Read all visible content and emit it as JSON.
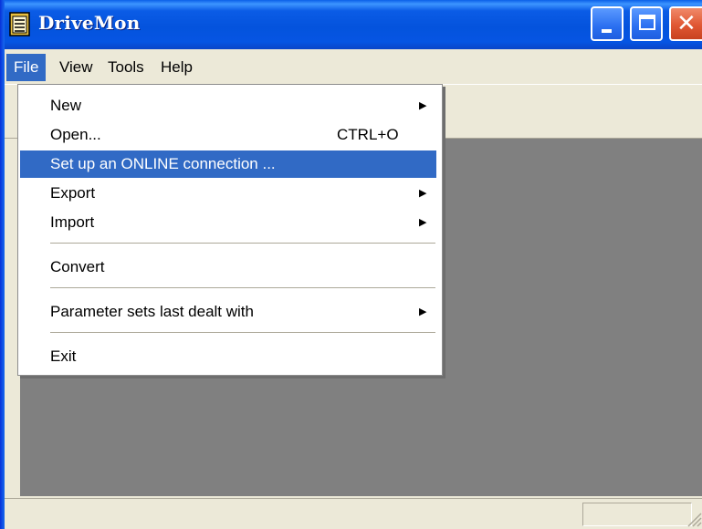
{
  "window": {
    "title": "DriveMon",
    "icon": "notepad-icon",
    "controls": {
      "minimize": "minimize-icon",
      "maximize": "maximize-icon",
      "close": "close-icon",
      "close_glyph": "✕"
    }
  },
  "menubar": {
    "items": [
      {
        "label": "File",
        "active": true
      },
      {
        "label": "View"
      },
      {
        "label": "Tools"
      },
      {
        "label": "Help"
      }
    ]
  },
  "file_menu": {
    "items": [
      {
        "label": "New",
        "submenu": true
      },
      {
        "label": "Open...",
        "shortcut": "CTRL+O"
      },
      {
        "label": "Set up an ONLINE connection ...",
        "highlighted": true
      },
      {
        "label": "Export",
        "submenu": true
      },
      {
        "label": "Import",
        "submenu": true
      },
      {
        "label": "Convert"
      },
      {
        "label": "Parameter sets last dealt with",
        "submenu": true
      },
      {
        "label": "Exit"
      }
    ],
    "submenu_arrow": "▶"
  },
  "colors": {
    "titlebar": "#0453dd",
    "highlight": "#316ac5",
    "client_bg": "#808080",
    "chrome_bg": "#ece9d8"
  }
}
